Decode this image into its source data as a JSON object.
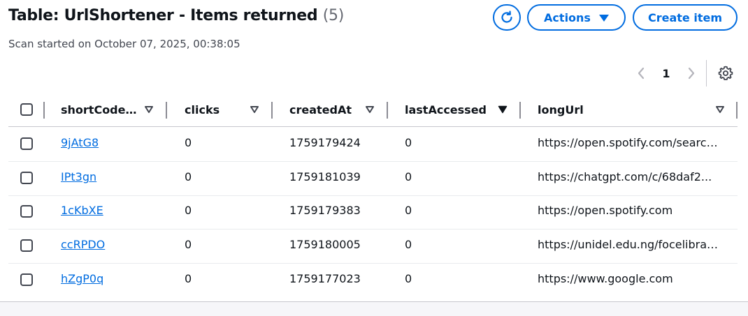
{
  "header": {
    "title": "Table: UrlShortener - Items returned",
    "count": "(5)",
    "subtitle": "Scan started on October 07, 2025, 00:38:05",
    "actions_label": "Actions",
    "create_label": "Create item"
  },
  "pagination": {
    "current_page": "1"
  },
  "icons": {
    "refresh": "refresh-icon",
    "actions_caret": "caret-down-icon",
    "prev": "chevron-left-icon",
    "next": "chevron-right-icon",
    "settings": "gear-icon",
    "sort": "sort-caret-icon"
  },
  "colors": {
    "accent": "#006ce0",
    "text": "#0f141a",
    "muted": "#656871"
  },
  "table": {
    "columns": [
      {
        "label": "shortCode..."
      },
      {
        "label": "clicks"
      },
      {
        "label": "createdAt"
      },
      {
        "label": "lastAccessed"
      },
      {
        "label": "longUrl"
      }
    ],
    "rows": [
      {
        "shortCode": "9jAtG8",
        "clicks": "0",
        "createdAt": "1759179424",
        "lastAccessed": "0",
        "longUrl": "https://open.spotify.com/search/..."
      },
      {
        "shortCode": "IPt3gn",
        "clicks": "0",
        "createdAt": "1759181039",
        "lastAccessed": "0",
        "longUrl": "https://chatgpt.com/c/68daf2..."
      },
      {
        "shortCode": "1cKbXE",
        "clicks": "0",
        "createdAt": "1759179383",
        "lastAccessed": "0",
        "longUrl": "https://open.spotify.com"
      },
      {
        "shortCode": "ccRPDO",
        "clicks": "0",
        "createdAt": "1759180005",
        "lastAccessed": "0",
        "longUrl": "https://unidel.edu.ng/focelibrary..."
      },
      {
        "shortCode": "hZgP0q",
        "clicks": "0",
        "createdAt": "1759177023",
        "lastAccessed": "0",
        "longUrl": "https://www.google.com"
      }
    ]
  }
}
